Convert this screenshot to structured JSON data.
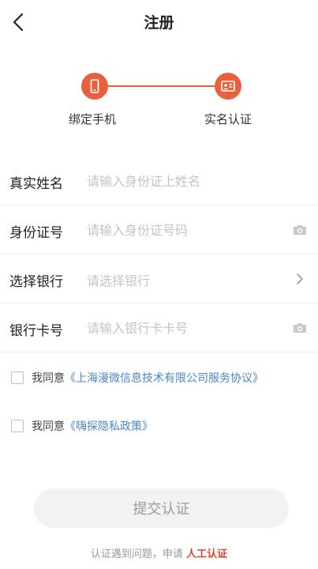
{
  "header": {
    "title": "注册",
    "back_icon": "chevron-left-icon"
  },
  "stepper": {
    "accent_color": "#e9603f",
    "steps": [
      {
        "label": "绑定手机",
        "icon": "phone-icon",
        "status": "done"
      },
      {
        "label": "实名认证",
        "icon": "id-card-icon",
        "status": "active"
      }
    ]
  },
  "form": {
    "real_name": {
      "label": "真实姓名",
      "value": "",
      "placeholder": "请输入身份证上姓名"
    },
    "id_number": {
      "label": "身份证号",
      "value": "",
      "placeholder": "请输入身份证号码",
      "icon": "camera-icon"
    },
    "bank": {
      "label": "选择银行",
      "value": "请选择银行",
      "icon": "chevron-right-icon"
    },
    "card_number": {
      "label": "银行卡号",
      "value": "",
      "placeholder": "请输入银行卡卡号",
      "icon": "camera-icon"
    }
  },
  "agreements": [
    {
      "prefix": "我同意",
      "link": "《上海漫微信息技术有限公司服务协议》",
      "checked": false
    },
    {
      "prefix": "我同意",
      "link": "《嗨探隐私政策》",
      "checked": false
    }
  ],
  "submit": {
    "label": "提交认证",
    "enabled": false
  },
  "footer": {
    "text": "认证遇到问题，申请",
    "link": "人工认证",
    "link_color": "#d9472f"
  }
}
